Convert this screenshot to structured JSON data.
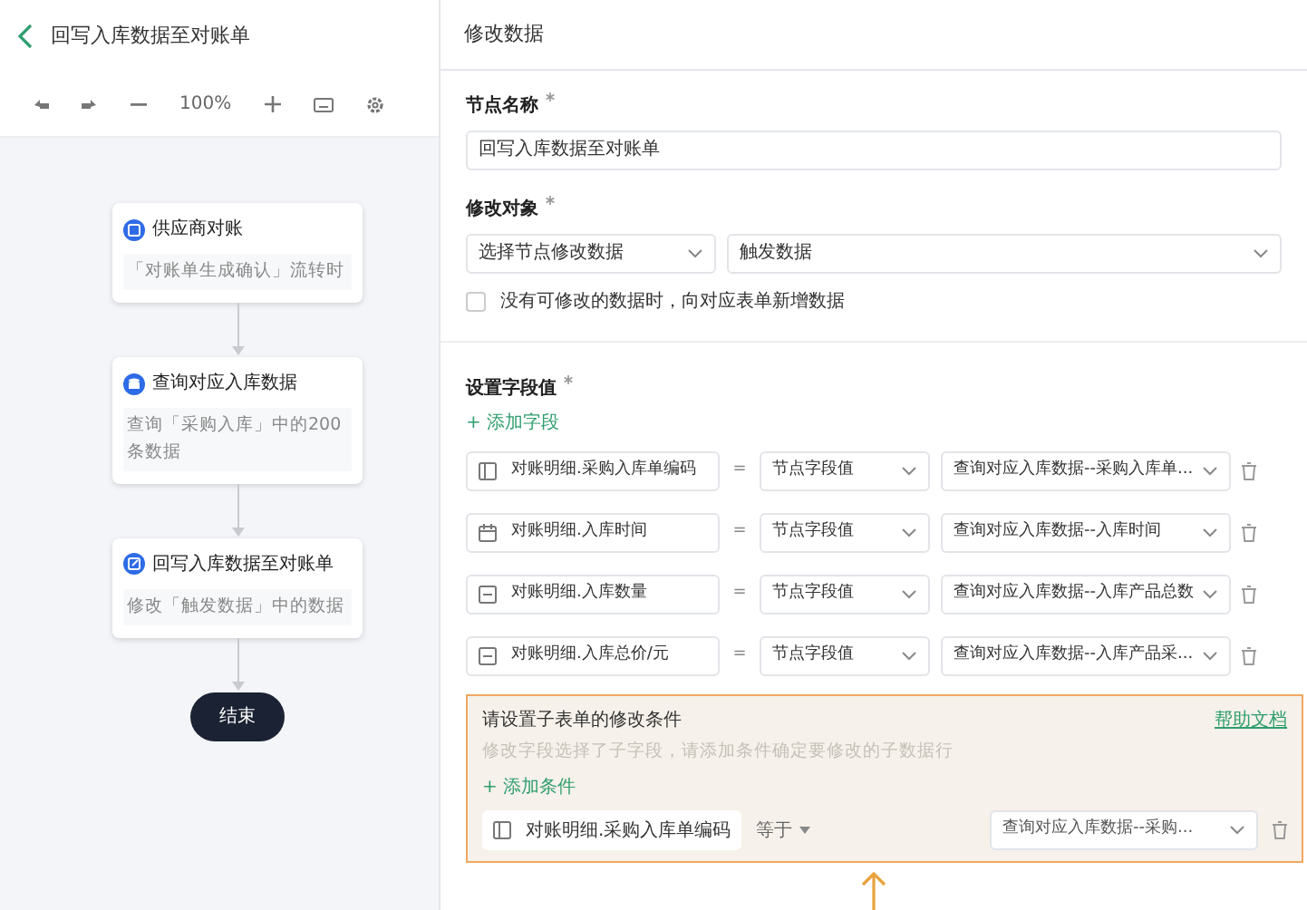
{
  "flow": {
    "title": "回写入库数据至对账单",
    "zoom": "100%",
    "nodes": [
      {
        "kind": "trigger",
        "title": "供应商对账",
        "desc": "「对账单生成确认」流转时"
      },
      {
        "kind": "query",
        "title": "查询对应入库数据",
        "desc": "查询「采购入库」中的200条数据"
      },
      {
        "kind": "update",
        "title": "回写入库数据至对账单",
        "desc": "修改「触发数据」中的数据"
      },
      {
        "kind": "end",
        "title": "结束"
      }
    ]
  },
  "panel": {
    "title": "修改数据",
    "node_name": {
      "label": "节点名称",
      "required": true,
      "value": "回写入库数据至对账单"
    },
    "target": {
      "label": "修改对象",
      "required": true,
      "select_1": "选择节点修改数据",
      "select_2": "触发数据"
    },
    "add_if_missing": {
      "label": "没有可修改的数据时，向对应表单新增数据",
      "checked": false
    },
    "fields": {
      "label": "设置字段值",
      "required": true,
      "add": "+ 添加字段",
      "rows": [
        {
          "kind": "text",
          "field": "对账明细.采购入库单编码",
          "op": "=",
          "source": "节点字段值",
          "value": "查询对应入库数据--采购入库单..."
        },
        {
          "kind": "date",
          "field": "对账明细.入库时间",
          "op": "=",
          "source": "节点字段值",
          "value": "查询对应入库数据--入库时间"
        },
        {
          "kind": "number",
          "field": "对账明细.入库数量",
          "op": "=",
          "source": "节点字段值",
          "value": "查询对应入库数据--入库产品总数"
        },
        {
          "kind": "number",
          "field": "对账明细.入库总价/元",
          "op": "=",
          "source": "节点字段值",
          "value": "查询对应入库数据--入库产品采..."
        }
      ]
    },
    "condition": {
      "title": "请设置子表单的修改条件",
      "help": "帮助文档",
      "hint": "修改字段选择了子字段，请添加条件确定要修改的子数据行",
      "add": "+ 添加条件",
      "row": {
        "field": "对账明细.采购入库单编码",
        "op": "等于",
        "value": "查询对应入库数据--采购..."
      }
    }
  }
}
